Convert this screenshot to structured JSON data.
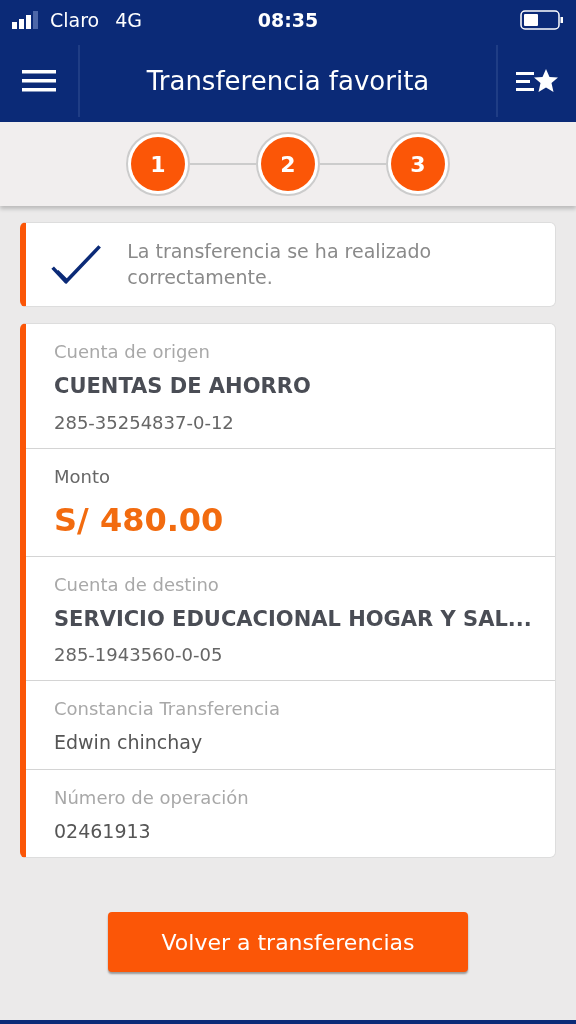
{
  "status_bar": {
    "carrier": "Claro",
    "network": "4G",
    "time": "08:35"
  },
  "header": {
    "title": "Transferencia favorita"
  },
  "steps": [
    {
      "label": "1",
      "selected": true
    },
    {
      "label": "2",
      "selected": true
    },
    {
      "label": "3",
      "selected": true
    }
  ],
  "message": "La transferencia se ha realizado correctamente.",
  "details": [
    {
      "kind": "account",
      "label": "Cuenta de origen",
      "value": "CUENTAS DE AHORRO",
      "detail": "285-35254837-0-12"
    },
    {
      "kind": "amount",
      "label": "Monto",
      "value": "S/ 480.00"
    },
    {
      "kind": "account",
      "label": "Cuenta de destino",
      "value": "SERVICIO EDUCACIONAL HOGAR Y SAL...",
      "detail": "285-1943560-0-05"
    },
    {
      "kind": "text",
      "label": "Constancia Transferencia",
      "value": "Edwin chinchay"
    },
    {
      "kind": "text",
      "label": "Número de operación",
      "value": "02461913"
    }
  ],
  "button": "Volver a transferencias"
}
